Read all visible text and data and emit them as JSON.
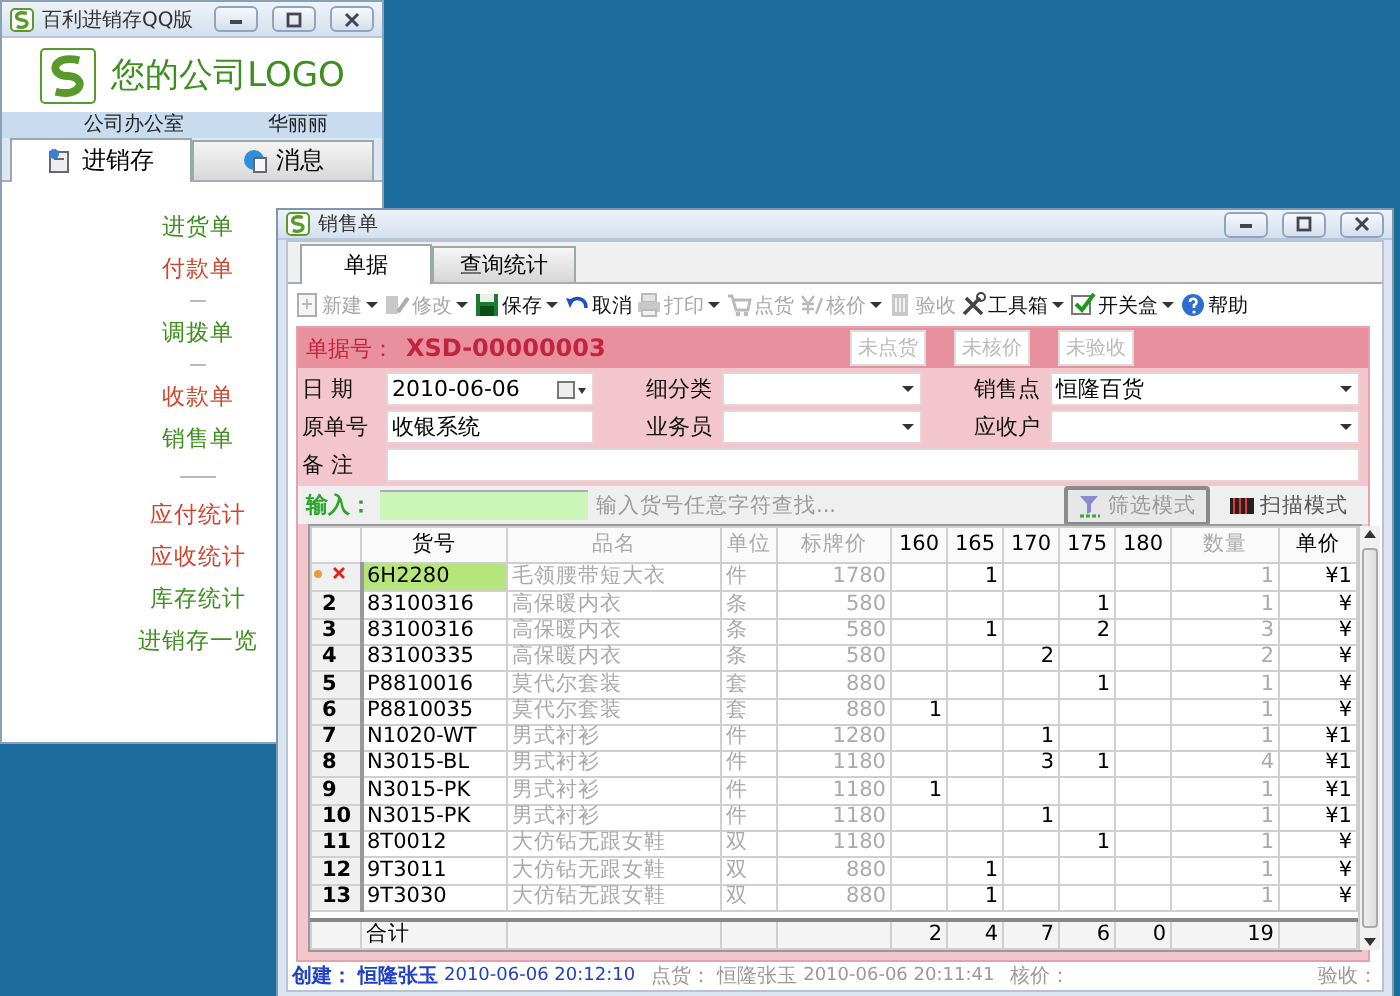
{
  "launcher": {
    "title": "百利进销存QQ版",
    "logo_text": "您的公司LOGO",
    "office": "公司办公室",
    "user": "华丽丽",
    "tabs": [
      {
        "label": "进销存",
        "selected": true
      },
      {
        "label": "消息",
        "selected": false
      }
    ],
    "menu": [
      {
        "kind": "link",
        "label": "进货单",
        "color": "#3f8f1f"
      },
      {
        "kind": "link",
        "label": "付款单",
        "color": "#d0452e"
      },
      {
        "kind": "separator"
      },
      {
        "kind": "link",
        "label": "调拨单",
        "color": "#3f8f1f"
      },
      {
        "kind": "separator"
      },
      {
        "kind": "link",
        "label": "收款单",
        "color": "#d0452e"
      },
      {
        "kind": "link",
        "label": "销售单",
        "color": "#3f8f1f"
      },
      {
        "kind": "separator"
      },
      {
        "kind": "link",
        "label": "应付统计",
        "color": "#d0452e"
      },
      {
        "kind": "link",
        "label": "应收统计",
        "color": "#d0452e"
      },
      {
        "kind": "link",
        "label": "库存统计",
        "color": "#3f8f1f"
      },
      {
        "kind": "link",
        "label": "进销存一览",
        "color": "#3f8f1f"
      }
    ]
  },
  "sales": {
    "title": "销售单",
    "tabs": [
      {
        "label": "单据",
        "selected": true
      },
      {
        "label": "查询统计",
        "selected": false
      }
    ],
    "toolbar": [
      {
        "label": "新建",
        "disabled": true,
        "dropdown": true
      },
      {
        "label": "修改",
        "disabled": true,
        "dropdown": true
      },
      {
        "label": "保存",
        "disabled": false,
        "dropdown": true
      },
      {
        "label": "取消",
        "disabled": false,
        "dropdown": false
      },
      {
        "label": "打印",
        "disabled": true,
        "dropdown": true
      },
      {
        "label": "点货",
        "disabled": true,
        "dropdown": false
      },
      {
        "label": "核价",
        "disabled": true,
        "dropdown": true
      },
      {
        "label": "验收",
        "disabled": true,
        "dropdown": false
      },
      {
        "label": "工具箱",
        "disabled": false,
        "dropdown": true
      },
      {
        "label": "开关盒",
        "disabled": false,
        "dropdown": true
      },
      {
        "label": "帮助",
        "disabled": false,
        "dropdown": false
      }
    ],
    "doc_label": "单据号：",
    "doc_number": "XSD-00000003",
    "status_buttons": [
      {
        "label": "未点货",
        "disabled": true
      },
      {
        "label": "未核价",
        "disabled": true
      },
      {
        "label": "未验收",
        "disabled": true
      }
    ],
    "fields": [
      {
        "label": "日 期",
        "kind": "date",
        "value": "2010-06-06"
      },
      {
        "label": "细分类",
        "kind": "dropdown"
      },
      {
        "label": "销售点",
        "kind": "dropdown",
        "value": "恒隆百货"
      },
      {
        "label": "原单号",
        "kind": "text",
        "value": "收银系统"
      },
      {
        "label": "业务员",
        "kind": "dropdown"
      },
      {
        "label": "应收户",
        "kind": "dropdown"
      },
      {
        "label": "备 注",
        "kind": "wide"
      }
    ],
    "input_label": "输入：",
    "input_hint": "输入货号任意字符查找...",
    "modes": [
      {
        "label": "筛选模式",
        "selected": true
      },
      {
        "label": "扫描模式",
        "selected": false
      }
    ],
    "table": {
      "columns": [
        {
          "label": "货号",
          "readonly": false
        },
        {
          "label": "品名",
          "readonly": true
        },
        {
          "label": "单位",
          "readonly": true
        },
        {
          "label": "标牌价",
          "readonly": true
        },
        {
          "label": "160",
          "readonly": false
        },
        {
          "label": "165",
          "readonly": false
        },
        {
          "label": "170",
          "readonly": false
        },
        {
          "label": "175",
          "readonly": false
        },
        {
          "label": "180",
          "readonly": false
        },
        {
          "label": "数量",
          "readonly": true
        },
        {
          "label": "单价",
          "readonly": false
        }
      ],
      "rows": [
        {
          "selected": true,
          "cells": [
            "6H2280",
            "毛领腰带短大衣",
            "件",
            "1780",
            null,
            "1",
            null,
            null,
            null,
            "1",
            "¥1"
          ]
        },
        {
          "selected": false,
          "no": "2",
          "cells": [
            "83100316",
            "高保暖内衣",
            "条",
            "580",
            null,
            null,
            null,
            "1",
            null,
            "1",
            "¥"
          ]
        },
        {
          "selected": false,
          "no": "3",
          "cells": [
            "83100316",
            "高保暖内衣",
            "条",
            "580",
            null,
            "1",
            null,
            "2",
            null,
            "3",
            "¥"
          ]
        },
        {
          "selected": false,
          "no": "4",
          "cells": [
            "83100335",
            "高保暖内衣",
            "条",
            "580",
            null,
            null,
            "2",
            null,
            null,
            "2",
            "¥"
          ]
        },
        {
          "selected": false,
          "no": "5",
          "cells": [
            "P8810016",
            "莫代尔套装",
            "套",
            "880",
            null,
            null,
            null,
            "1",
            null,
            "1",
            "¥"
          ]
        },
        {
          "selected": false,
          "no": "6",
          "cells": [
            "P8810035",
            "莫代尔套装",
            "套",
            "880",
            "1",
            null,
            null,
            null,
            null,
            "1",
            "¥"
          ]
        },
        {
          "selected": false,
          "no": "7",
          "cells": [
            "N1020-WT",
            "男式衬衫",
            "件",
            "1280",
            null,
            null,
            "1",
            null,
            null,
            "1",
            "¥1"
          ]
        },
        {
          "selected": false,
          "no": "8",
          "cells": [
            "N3015-BL",
            "男式衬衫",
            "件",
            "1180",
            null,
            null,
            "3",
            "1",
            null,
            "4",
            "¥1"
          ]
        },
        {
          "selected": false,
          "no": "9",
          "cells": [
            "N3015-PK",
            "男式衬衫",
            "件",
            "1180",
            "1",
            null,
            null,
            null,
            null,
            "1",
            "¥1"
          ]
        },
        {
          "selected": false,
          "no": "10",
          "cells": [
            "N3015-PK",
            "男式衬衫",
            "件",
            "1180",
            null,
            null,
            "1",
            null,
            null,
            "1",
            "¥1"
          ]
        },
        {
          "selected": false,
          "no": "11",
          "cells": [
            "8T0012",
            "大仿钻无跟女鞋",
            "双",
            "1180",
            null,
            null,
            null,
            "1",
            null,
            "1",
            "¥"
          ]
        },
        {
          "selected": false,
          "no": "12",
          "cells": [
            "9T3011",
            "大仿钻无跟女鞋",
            "双",
            "880",
            null,
            "1",
            null,
            null,
            null,
            "1",
            "¥"
          ]
        },
        {
          "selected": false,
          "no": "13",
          "cells": [
            "9T3030",
            "大仿钻无跟女鞋",
            "双",
            "880",
            null,
            "1",
            null,
            null,
            null,
            "1",
            "¥"
          ]
        }
      ],
      "total": {
        "label": "合计",
        "cells": [
          null,
          null,
          null,
          "2",
          "4",
          "7",
          "6",
          "0",
          "19",
          null
        ]
      }
    },
    "footer": [
      {
        "label": "创建：",
        "user": "恒隆张玉",
        "time": "2010-06-06 20:12:10",
        "active": true
      },
      {
        "label": "点货：",
        "user": "恒隆张玉",
        "time": "2010-06-06 20:11:41",
        "active": false
      },
      {
        "label": "核价：",
        "active": false
      },
      {
        "label": "验收：",
        "active": false
      }
    ]
  }
}
